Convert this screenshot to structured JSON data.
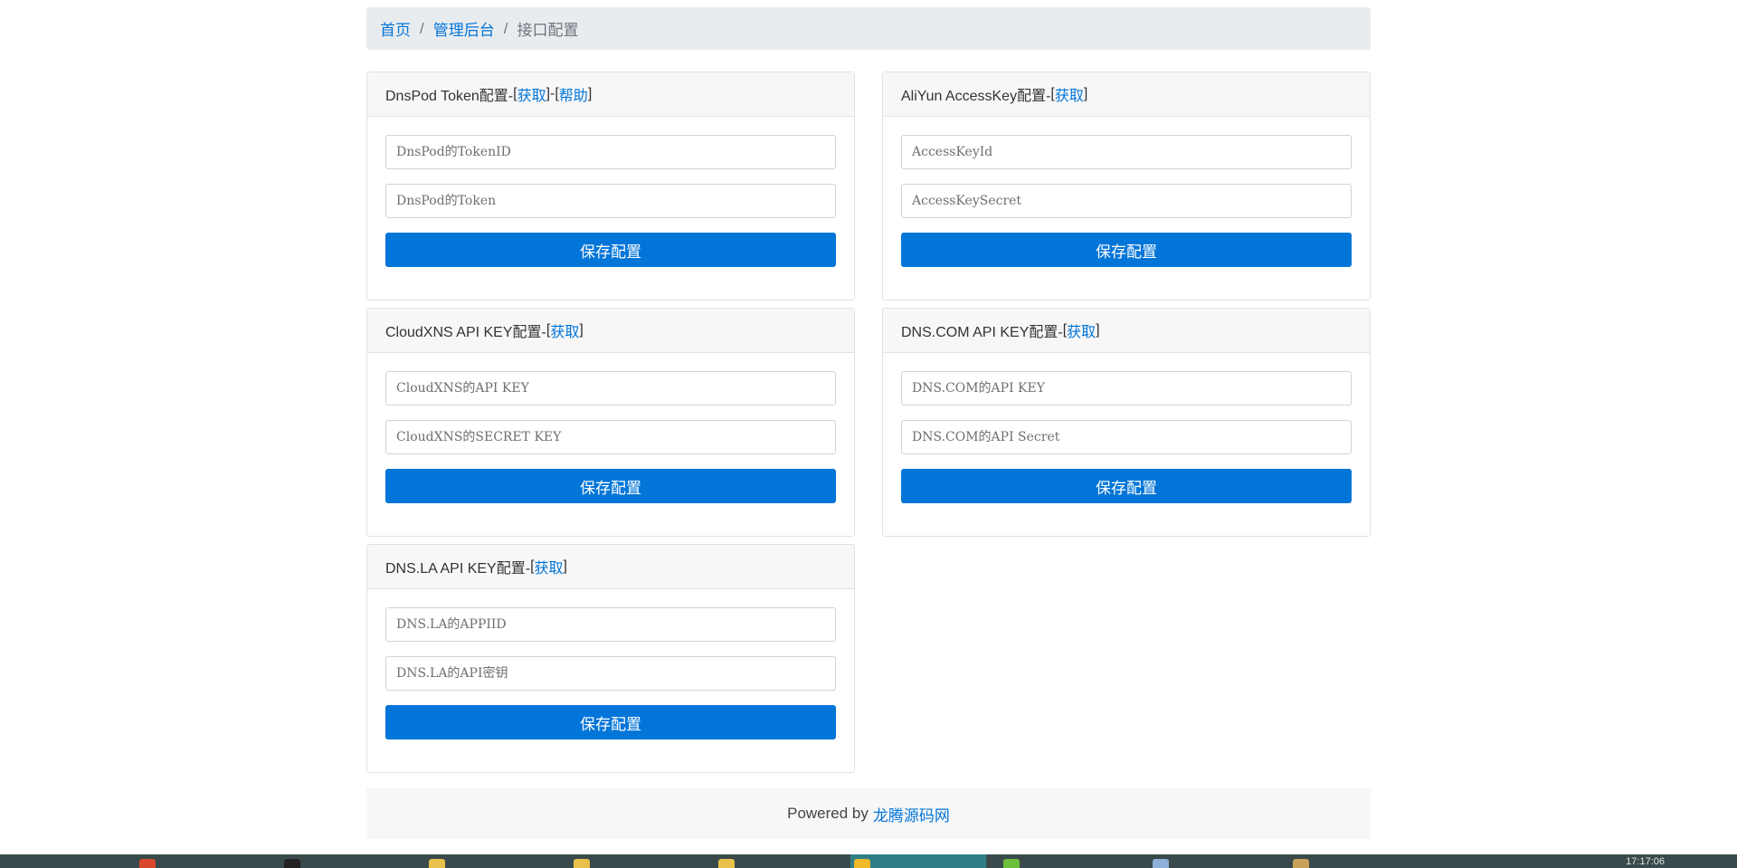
{
  "breadcrumb": {
    "home": "首页",
    "admin": "管理后台",
    "current": "接口配置"
  },
  "cards": {
    "dnspod": {
      "title": "DnsPod Token配置-",
      "links": [
        "获取",
        "帮助"
      ],
      "fields": [
        "DnsPod的TokenID",
        "DnsPod的Token"
      ],
      "button": "保存配置"
    },
    "aliyun": {
      "title": "AliYun AccessKey配置-",
      "links": [
        "获取"
      ],
      "fields": [
        "AccessKeyId",
        "AccessKeySecret"
      ],
      "button": "保存配置"
    },
    "cloudxns": {
      "title": "CloudXNS API KEY配置-",
      "links": [
        "获取"
      ],
      "fields": [
        "CloudXNS的API KEY",
        "CloudXNS的SECRET KEY"
      ],
      "button": "保存配置"
    },
    "dnscom": {
      "title": "DNS.COM API KEY配置-",
      "links": [
        "获取"
      ],
      "fields": [
        "DNS.COM的API KEY",
        "DNS.COM的API Secret"
      ],
      "button": "保存配置"
    },
    "dnsla": {
      "title": "DNS.LA API KEY配置-",
      "links": [
        "获取"
      ],
      "fields": [
        "DNS.LA的APPIID",
        "DNS.LA的API密钥"
      ],
      "button": "保存配置"
    }
  },
  "footer": {
    "text": "Powered by",
    "link": "龙腾源码网"
  },
  "taskbar": {
    "clock": "17:17:06"
  },
  "colors": {
    "accent": "#0275d8",
    "taskbar": "#3a4a4c",
    "taskbar_active": "#2f7e86"
  }
}
